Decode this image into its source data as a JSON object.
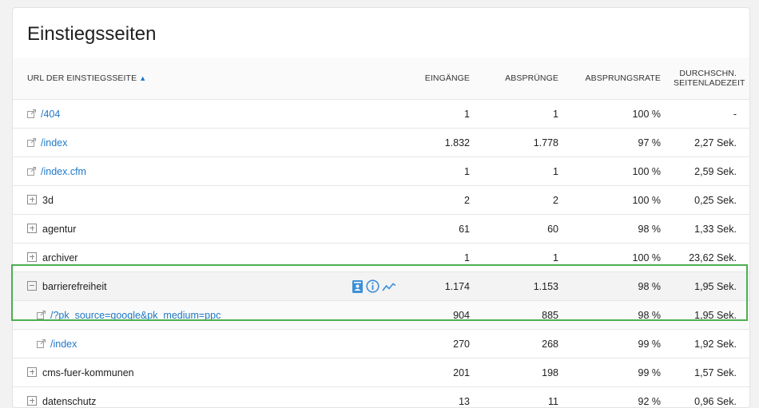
{
  "report": {
    "title": "Einstiegsseiten",
    "columns": {
      "label": "URL der Einstiegsseite",
      "entries": "Eingänge",
      "bounces": "Absprünge",
      "bounce_rate": "Absprungsrate",
      "load_time_line1": "Durchschn.",
      "load_time_line2": "Seitenladezeit"
    },
    "sort_indicator": "▲",
    "rows": [
      {
        "label": "/404",
        "entries": "1",
        "bounces": "1",
        "rate": "100 %",
        "time": "-"
      },
      {
        "label": "/index",
        "entries": "1.832",
        "bounces": "1.778",
        "rate": "97 %",
        "time": "2,27 Sek."
      },
      {
        "label": "/index.cfm",
        "entries": "1",
        "bounces": "1",
        "rate": "100 %",
        "time": "2,59 Sek."
      },
      {
        "label": "3d",
        "entries": "2",
        "bounces": "2",
        "rate": "100 %",
        "time": "0,25 Sek."
      },
      {
        "label": "agentur",
        "entries": "61",
        "bounces": "60",
        "rate": "98 %",
        "time": "1,33 Sek."
      },
      {
        "label": "archiver",
        "entries": "1",
        "bounces": "1",
        "rate": "100 %",
        "time": "23,62 Sek."
      },
      {
        "label": "barrierefreiheit",
        "entries": "1.174",
        "bounces": "1.153",
        "rate": "98 %",
        "time": "1,95 Sek."
      },
      {
        "label": "/?pk_source=google&pk_medium=ppc",
        "entries": "904",
        "bounces": "885",
        "rate": "98 %",
        "time": "1,95 Sek."
      },
      {
        "label": "/index",
        "entries": "270",
        "bounces": "268",
        "rate": "99 %",
        "time": "1,92 Sek."
      },
      {
        "label": "cms-fuer-kommunen",
        "entries": "201",
        "bounces": "198",
        "rate": "99 %",
        "time": "1,57 Sek."
      },
      {
        "label": "datenschutz",
        "entries": "13",
        "bounces": "11",
        "rate": "92 %",
        "time": "0,96 Sek."
      }
    ]
  },
  "colors": {
    "link": "#1f78c8",
    "highlight": "#4caf50",
    "icon_blue": "#3d8fd6"
  },
  "icons": [
    "external-link-icon",
    "expand-icon",
    "collapse-icon",
    "segmented-visitor-log-icon",
    "row-evolution-icon",
    "transitions-icon"
  ]
}
